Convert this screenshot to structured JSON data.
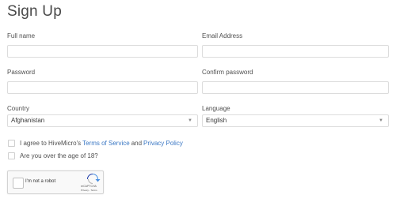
{
  "page": {
    "title": "Sign Up"
  },
  "fields": {
    "full_name": {
      "label": "Full name",
      "value": "",
      "placeholder": ""
    },
    "email": {
      "label": "Email Address",
      "value": "",
      "placeholder": ""
    },
    "password": {
      "label": "Password",
      "value": "",
      "placeholder": ""
    },
    "confirm_password": {
      "label": "Confirm password",
      "value": "",
      "placeholder": ""
    },
    "country": {
      "label": "Country",
      "value": "Afghanistan"
    },
    "language": {
      "label": "Language",
      "value": "English"
    }
  },
  "checkboxes": {
    "terms": {
      "prefix": "I agree to HiveMicro's",
      "terms_link": "Terms of Service",
      "and": "and",
      "privacy_link": "Privacy Policy",
      "checked": false
    },
    "age": {
      "label": "Are you over the age of 18?",
      "checked": false
    }
  },
  "recaptcha": {
    "label": "I'm not a robot",
    "brand": "reCAPTCHA",
    "privacy": "Privacy - Terms",
    "logo_icon": "recaptcha-logo-icon"
  },
  "colors": {
    "link": "#3b78c4",
    "border": "#dcdcdc"
  }
}
